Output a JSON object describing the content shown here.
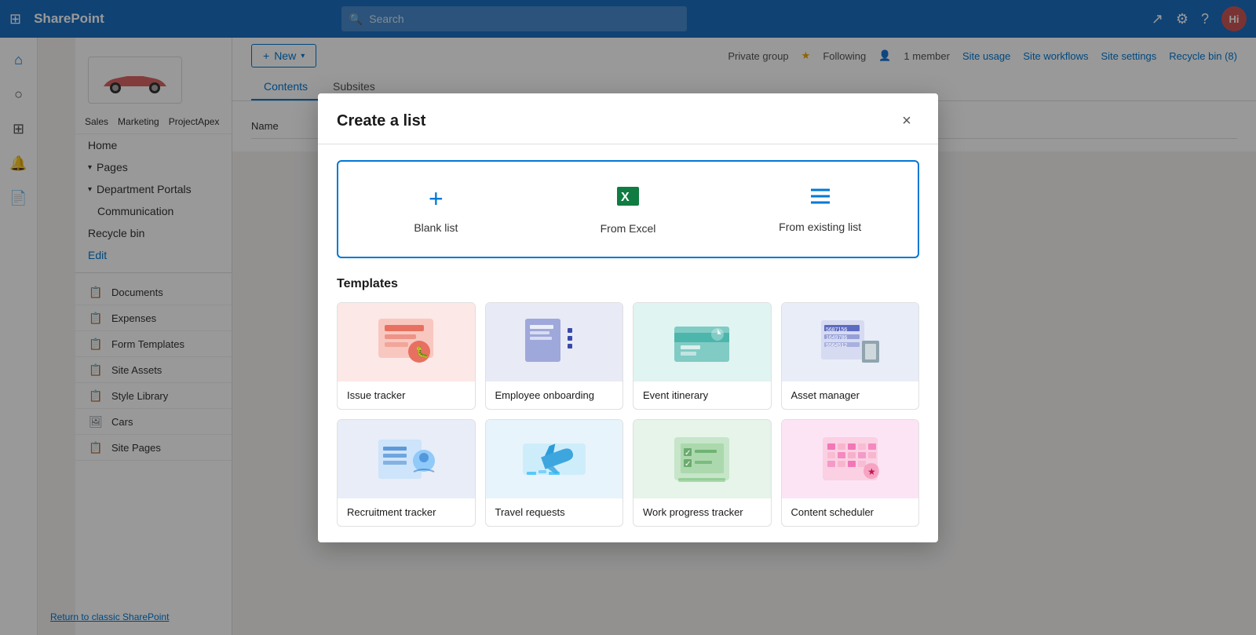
{
  "topNav": {
    "appTitle": "SharePoint",
    "searchPlaceholder": "Search",
    "avatarInitials": "Hi",
    "waffleIcon": "⊞"
  },
  "secondNav": {
    "links": [
      "Sales",
      "Marketing",
      "ProjectApex"
    ]
  },
  "leftSidebar": {
    "icons": [
      {
        "name": "home-icon",
        "symbol": "⌂"
      },
      {
        "name": "search-icon",
        "symbol": "○"
      },
      {
        "name": "apps-icon",
        "symbol": "⊞"
      },
      {
        "name": "bell-icon",
        "symbol": "🔔"
      },
      {
        "name": "page-icon",
        "symbol": "📄"
      }
    ]
  },
  "contentSidebar": {
    "homeLabel": "Home",
    "pagesSection": "Pages",
    "deptSection": "Department Portals",
    "items": [
      {
        "label": "Communication"
      },
      {
        "label": "Recycle bin"
      },
      {
        "label": "Edit"
      }
    ],
    "navItems": [
      {
        "label": "Documents",
        "icon": "📋"
      },
      {
        "label": "Expenses",
        "icon": "📋"
      },
      {
        "label": "Form Templates",
        "icon": "📋"
      },
      {
        "label": "Site Assets",
        "icon": "📋"
      },
      {
        "label": "Style Library",
        "icon": "📋"
      },
      {
        "label": "Cars",
        "icon": "🖼"
      },
      {
        "label": "Site Pages",
        "icon": "📋"
      }
    ],
    "returnLink": "Return to classic SharePoint"
  },
  "mainContent": {
    "newButton": "New",
    "tabs": [
      {
        "label": "Contents",
        "active": true
      },
      {
        "label": "Subsites",
        "active": false
      }
    ],
    "tableColumns": [
      "Name"
    ],
    "rightPanel": {
      "privateGroup": "Private group",
      "following": "Following",
      "memberCount": "1 member",
      "siteUsage": "Site usage",
      "siteWorkflows": "Site workflows",
      "siteSettings": "Site settings",
      "recyclebin": "Recycle bin (8)"
    }
  },
  "modal": {
    "title": "Create a list",
    "closeButton": "×",
    "createOptions": [
      {
        "label": "Blank list",
        "iconType": "plus"
      },
      {
        "label": "From Excel",
        "iconType": "excel"
      },
      {
        "label": "From existing list",
        "iconType": "list"
      }
    ],
    "templatesTitle": "Templates",
    "templates": [
      {
        "label": "Issue tracker",
        "thumbClass": "thumb-issue"
      },
      {
        "label": "Employee onboarding",
        "thumbClass": "thumb-employee"
      },
      {
        "label": "Event itinerary",
        "thumbClass": "thumb-event"
      },
      {
        "label": "Asset manager",
        "thumbClass": "thumb-asset"
      },
      {
        "label": "Recruitment tracker",
        "thumbClass": "thumb-recruitment"
      },
      {
        "label": "Travel requests",
        "thumbClass": "thumb-travel"
      },
      {
        "label": "Work progress tracker",
        "thumbClass": "thumb-work"
      },
      {
        "label": "Content scheduler",
        "thumbClass": "thumb-content"
      }
    ]
  }
}
